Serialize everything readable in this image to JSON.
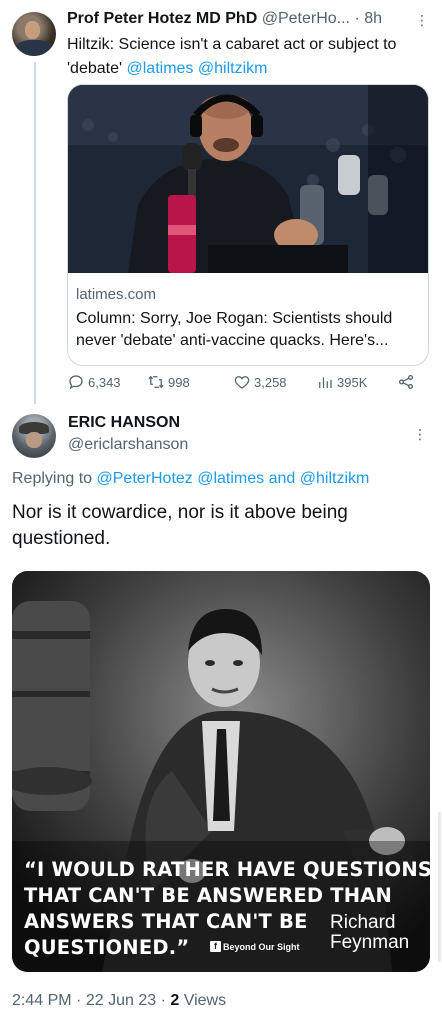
{
  "parent_tweet": {
    "name": "Prof Peter Hotez MD PhD",
    "handle": "@PeterHo...",
    "separator": "·",
    "time": "8h",
    "text_plain_1": "Hiltzik: Science isn't a cabaret act or subject to 'debate' ",
    "mention_1": "@latimes",
    "mention_2": "@hiltzikm",
    "card": {
      "domain": "latimes.com",
      "title": "Column: Sorry, Joe Rogan: Scientists should never 'debate' anti-vaccine quacks. Here's..."
    },
    "actions": {
      "replies": "6,343",
      "retweets": "998",
      "likes": "3,258",
      "views": "395K"
    },
    "icons": [
      "reply-icon",
      "retweet-icon",
      "like-icon",
      "views-icon",
      "share-icon"
    ]
  },
  "main_tweet": {
    "name": "ERIC HANSON",
    "handle": "@ericlarshanson",
    "replying_prefix": "Replying to ",
    "replying_mention_1": "@PeterHotez",
    "replying_mention_2": "@latimes",
    "replying_and": " and ",
    "replying_mention_3": "@hiltzikm",
    "text": "Nor is it cowardice, nor is it above being questioned.",
    "image": {
      "quote": "“I WOULD RATHER HAVE QUESTIONS\nTHAT CAN'T BE ANSWERED THAN\nANSWERS THAT CAN'T BE\nQUESTIONED.”",
      "author_line_1": "Richard",
      "author_line_2": "Feynman",
      "brand": "Beyond Our Sight",
      "brand_icon": "f"
    },
    "meta": {
      "time": "2:44 PM",
      "date": "22 Jun 23",
      "separator": "·",
      "views_count": "2",
      "views_label": "Views"
    }
  },
  "colors": {
    "text": "#0f1419",
    "secondary": "#536471",
    "link": "#1d9bf0",
    "border": "#cfd9de"
  }
}
